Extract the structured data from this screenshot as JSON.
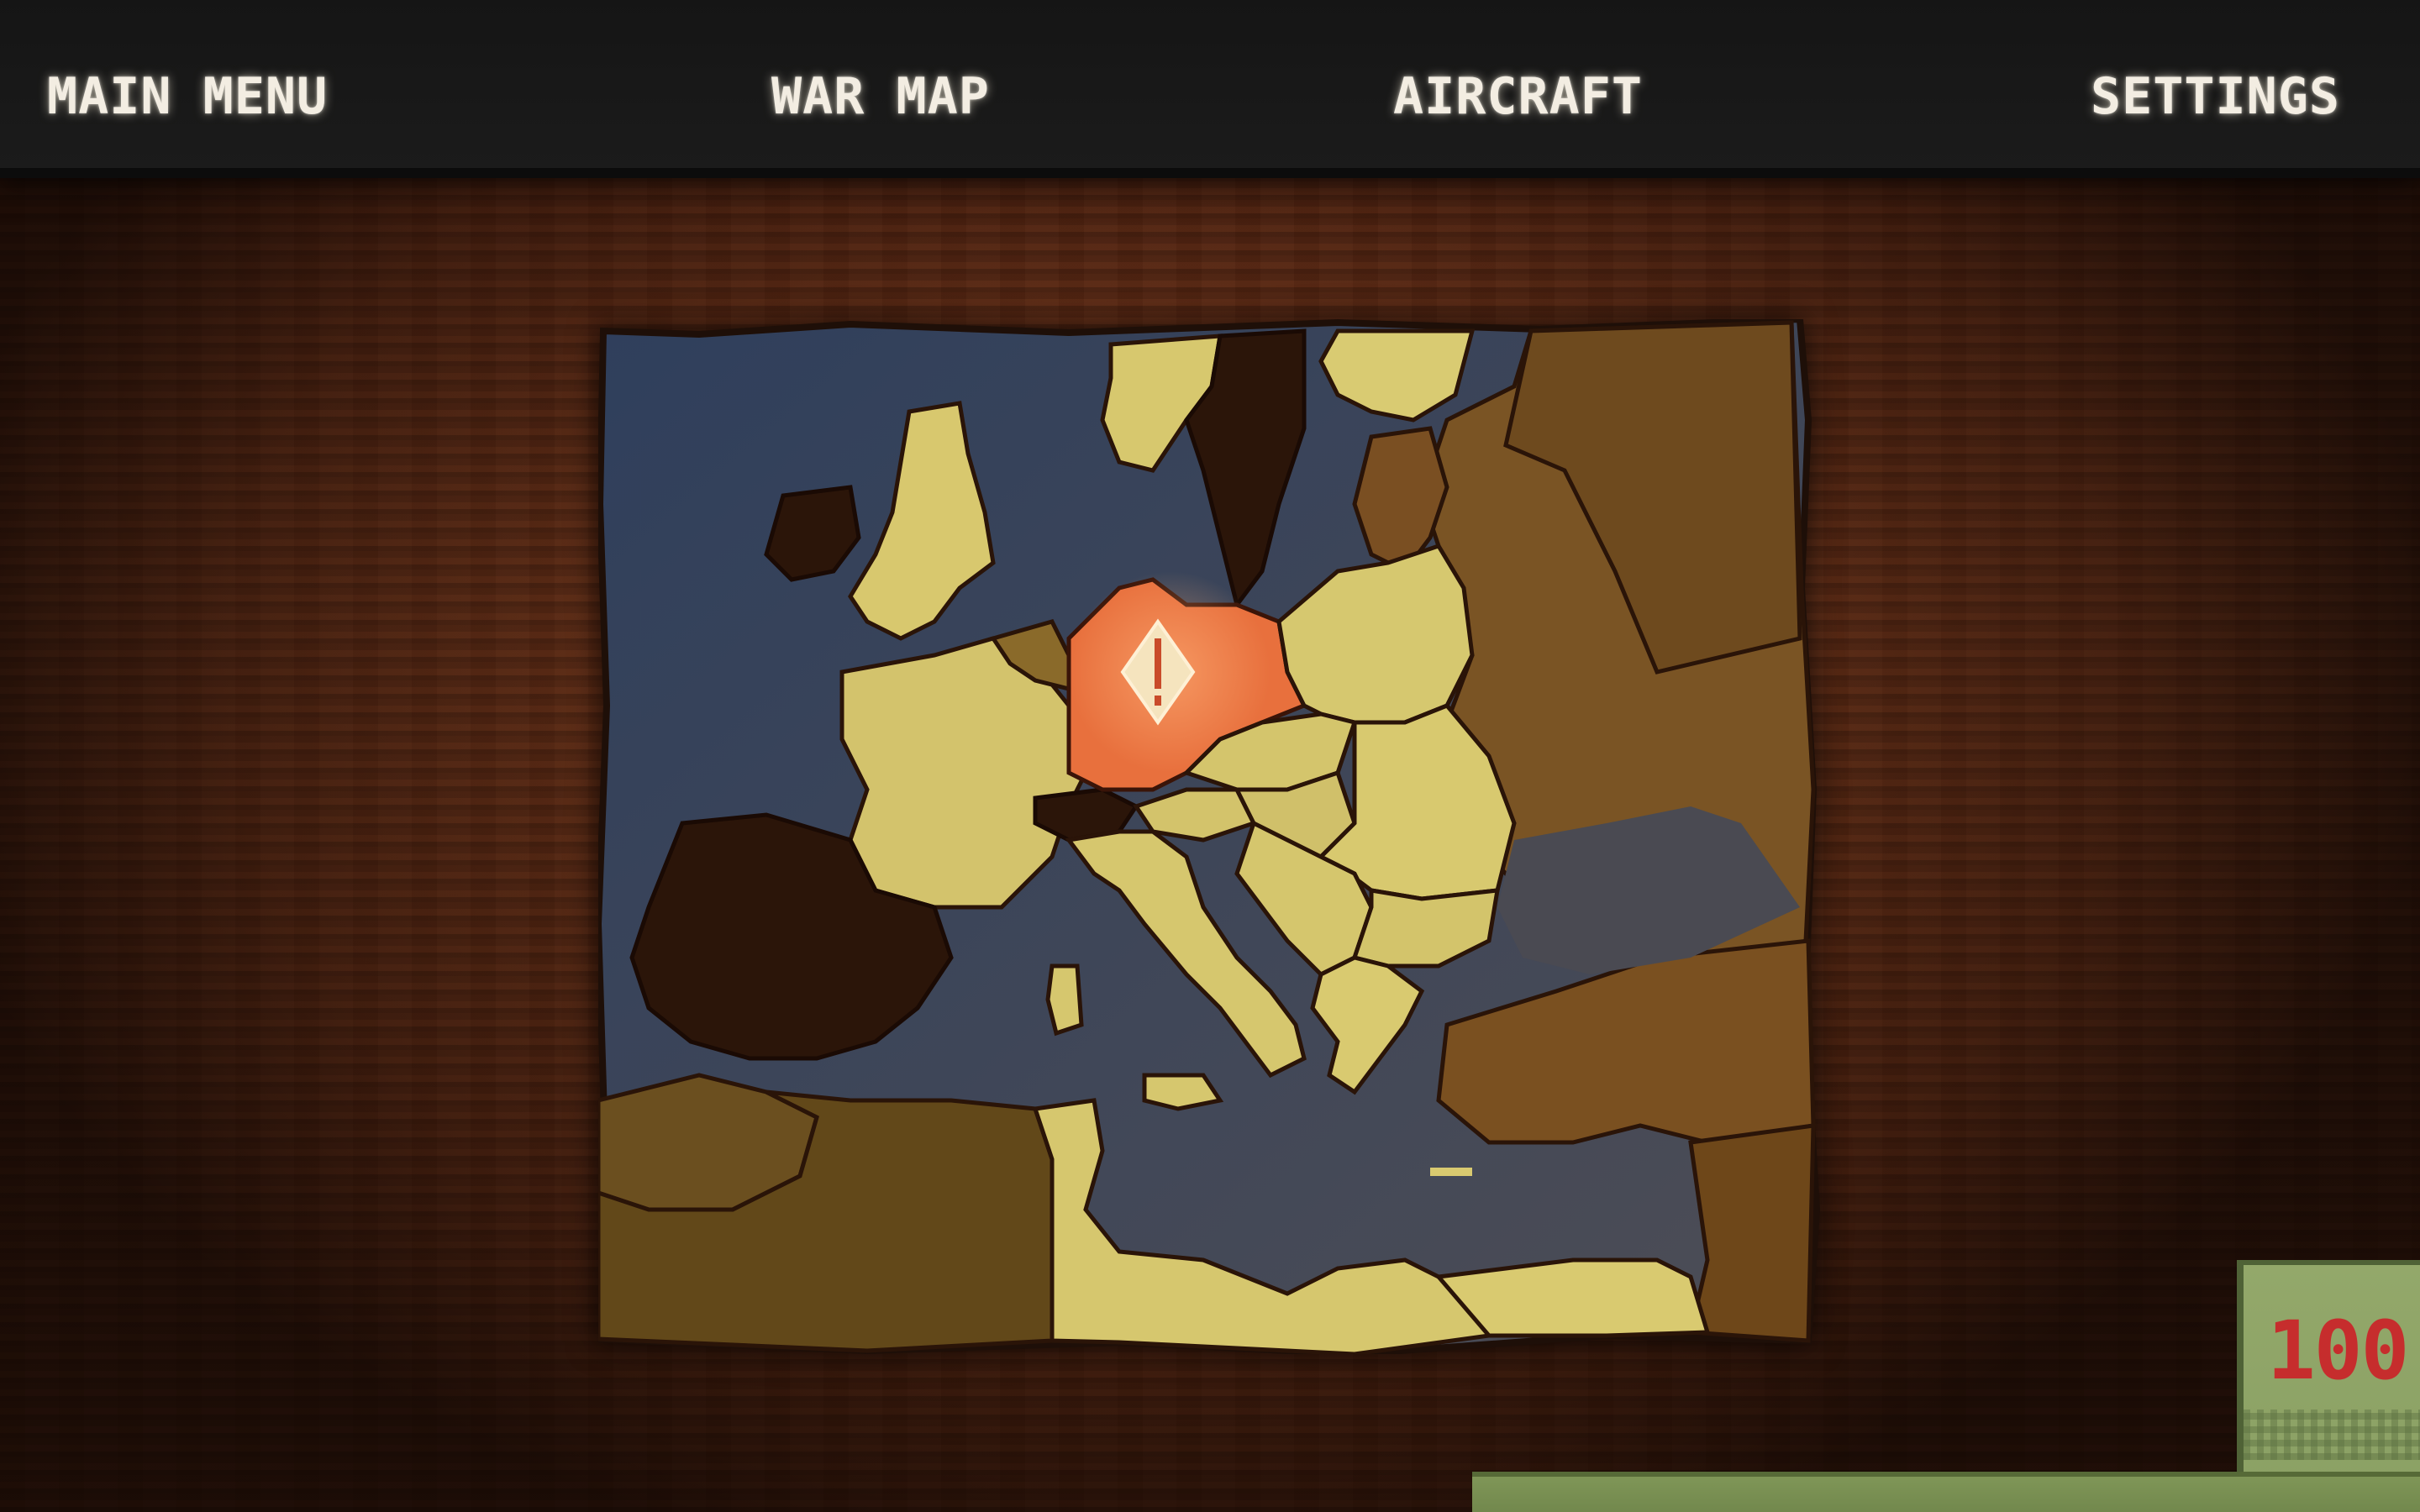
{
  "nav": {
    "main_menu": "MAIN MENU",
    "war_map": "WAR MAP",
    "aircraft": "AIRCRAFT",
    "settings": "SETTINGS"
  },
  "map": {
    "selected_region_color": "#e8703d",
    "allied_color": "#d8c874",
    "neutral_color": "#2a1610",
    "sea_color": "#3e4a5e",
    "marker_icon": "alert-diamond-icon"
  },
  "wallet": {
    "amount": "100"
  }
}
